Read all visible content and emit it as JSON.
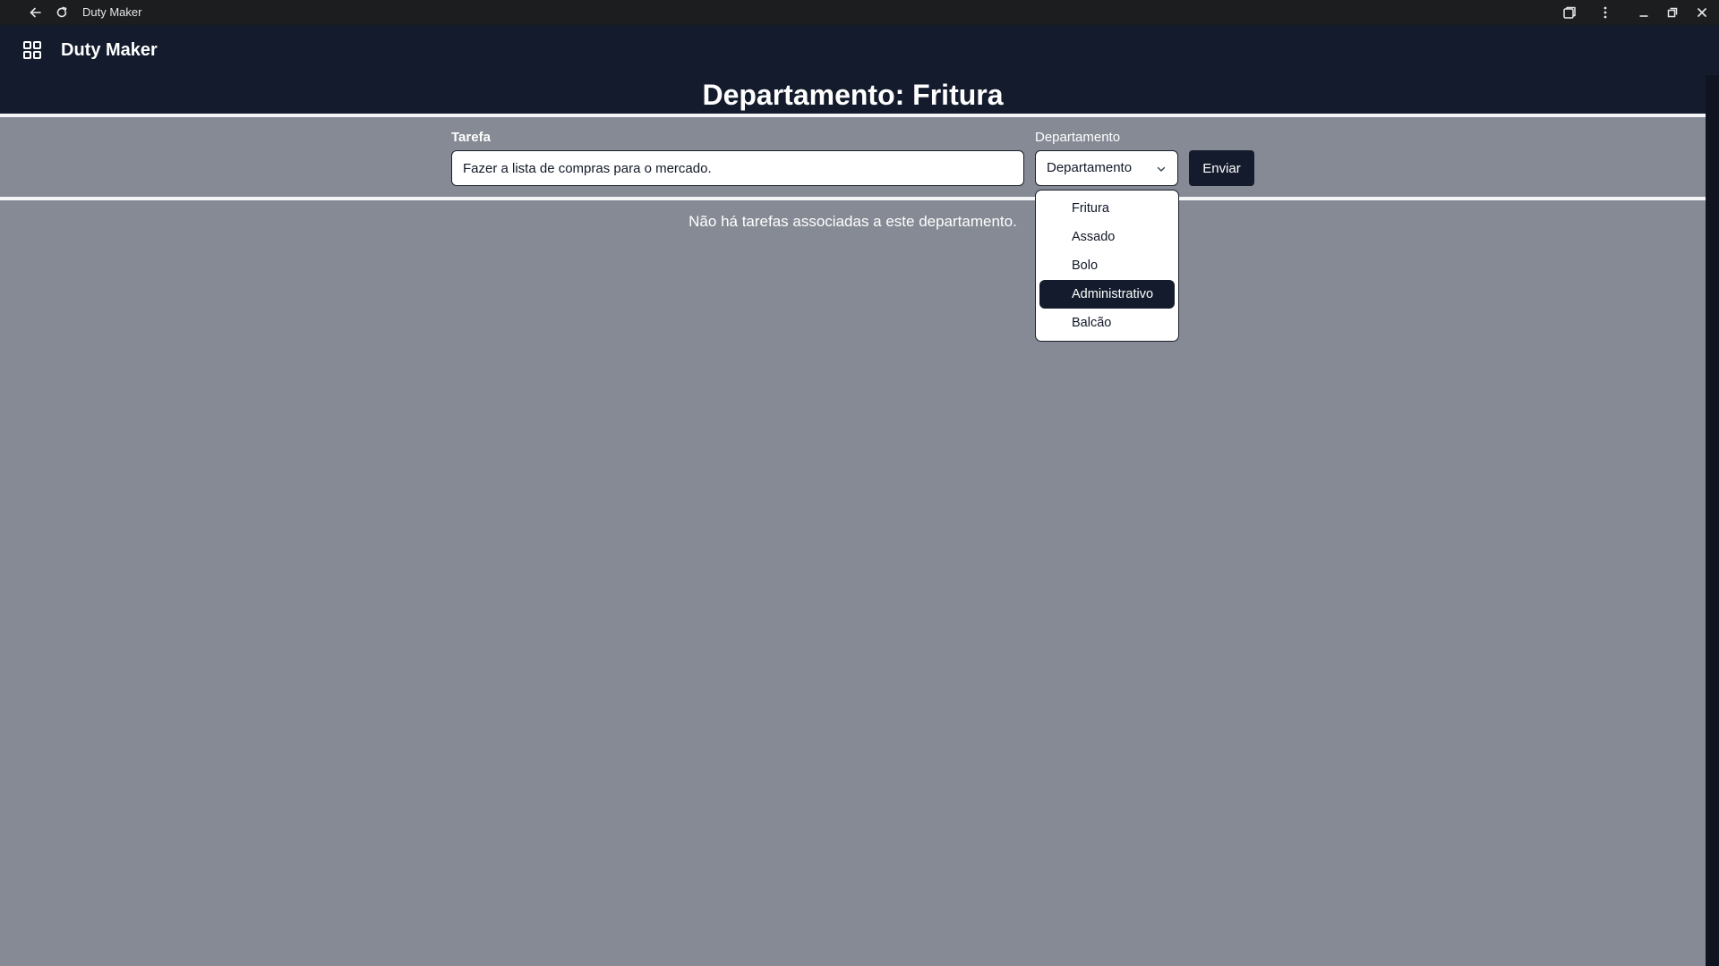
{
  "browser": {
    "window_title": "Duty Maker",
    "icons": [
      "back-arrow-icon",
      "reload-icon",
      "extensions-icon",
      "kebab-menu-icon",
      "minimize-icon",
      "restore-icon",
      "close-icon"
    ]
  },
  "header": {
    "app_name": "Duty Maker",
    "menu_icon": "grid-icon",
    "page_title": "Departamento: Fritura"
  },
  "form": {
    "task_label": "Tarefa",
    "task_value": "Fazer a lista de compras para o mercado.",
    "department_label": "Departamento",
    "department_selected": "Departamento",
    "submit_label": "Enviar"
  },
  "dropdown": {
    "options": [
      "Fritura",
      "Assado",
      "Bolo",
      "Administrativo",
      "Balcão"
    ],
    "highlighted": "Administrativo"
  },
  "content": {
    "empty_message": "Não há tarefas associadas a este departamento."
  },
  "colors": {
    "page_background": "#868a95",
    "header_background": "#131b2c",
    "chrome_background": "#1c1d1f",
    "accent_dark": "#131b2c"
  }
}
